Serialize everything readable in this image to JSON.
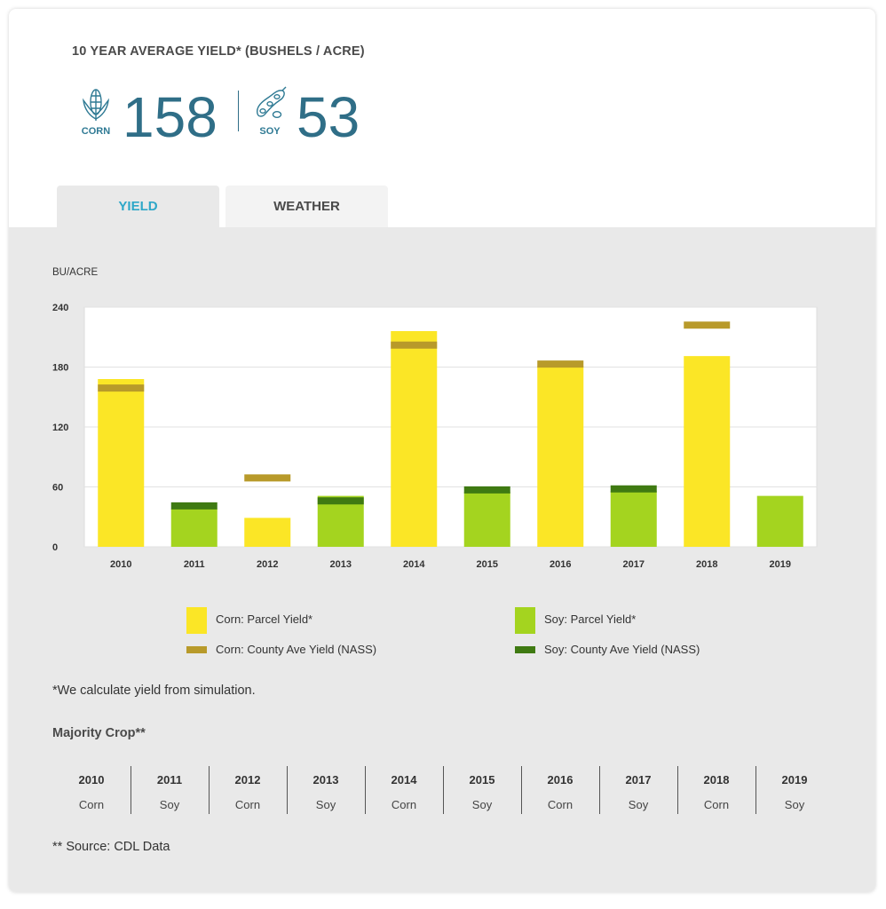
{
  "header": {
    "title": "10 YEAR AVERAGE YIELD* (BUSHELS / ACRE)",
    "corn": {
      "label": "CORN",
      "value": "158",
      "icon": "corn-icon"
    },
    "soy": {
      "label": "SOY",
      "value": "53",
      "icon": "soybean-icon"
    }
  },
  "tabs": [
    {
      "label": "YIELD",
      "active": true
    },
    {
      "label": "WEATHER",
      "active": false
    }
  ],
  "colors": {
    "corn_parcel": "#fbe626",
    "corn_county": "#b89a2a",
    "soy_parcel": "#a4d41f",
    "soy_county": "#3f7a12",
    "accent": "#2ea7c8",
    "stat": "#2f6e87"
  },
  "chart": {
    "unit_label": "BU/ACRE"
  },
  "chart_data": {
    "type": "bar",
    "categories": [
      "2010",
      "2011",
      "2012",
      "2013",
      "2014",
      "2015",
      "2016",
      "2017",
      "2018",
      "2019"
    ],
    "crop": [
      "Corn",
      "Soy",
      "Corn",
      "Soy",
      "Corn",
      "Soy",
      "Corn",
      "Soy",
      "Corn",
      "Soy"
    ],
    "series": [
      {
        "name": "Corn: Parcel Yield*",
        "values": [
          168,
          null,
          29,
          null,
          216,
          null,
          181,
          null,
          191,
          null
        ]
      },
      {
        "name": "Soy: Parcel Yield*",
        "values": [
          null,
          38,
          null,
          51,
          null,
          55,
          null,
          56,
          null,
          51
        ]
      },
      {
        "name": "Corn: County Ave Yield (NASS)",
        "values": [
          159,
          null,
          69,
          null,
          202,
          null,
          183,
          null,
          222,
          null
        ]
      },
      {
        "name": "Soy: County Ave Yield (NASS)",
        "values": [
          null,
          41,
          null,
          46,
          null,
          57,
          null,
          58,
          null,
          null
        ]
      }
    ],
    "yticks": [
      "0",
      "60",
      "120",
      "180",
      "240"
    ],
    "ylim": [
      0,
      240
    ],
    "grid": true,
    "legend_placement": "bottom"
  },
  "legend": [
    {
      "label": "Corn: Parcel Yield*",
      "kind": "bar",
      "color": "#fbe626"
    },
    {
      "label": "Soy: Parcel Yield*",
      "kind": "bar",
      "color": "#a4d41f"
    },
    {
      "label": "Corn: County Ave Yield (NASS)",
      "kind": "line",
      "color": "#b89a2a"
    },
    {
      "label": "Soy: County Ave Yield (NASS)",
      "kind": "line",
      "color": "#3f7a12"
    }
  ],
  "footnote_simulation": "*We calculate yield from simulation.",
  "majority_crop": {
    "title": "Majority Crop**",
    "rows": [
      {
        "year": "2010",
        "crop": "Corn"
      },
      {
        "year": "2011",
        "crop": "Soy"
      },
      {
        "year": "2012",
        "crop": "Corn"
      },
      {
        "year": "2013",
        "crop": "Soy"
      },
      {
        "year": "2014",
        "crop": "Corn"
      },
      {
        "year": "2015",
        "crop": "Soy"
      },
      {
        "year": "2016",
        "crop": "Corn"
      },
      {
        "year": "2017",
        "crop": "Soy"
      },
      {
        "year": "2018",
        "crop": "Corn"
      },
      {
        "year": "2019",
        "crop": "Soy"
      }
    ]
  },
  "footnote_source": "** Source: CDL Data"
}
